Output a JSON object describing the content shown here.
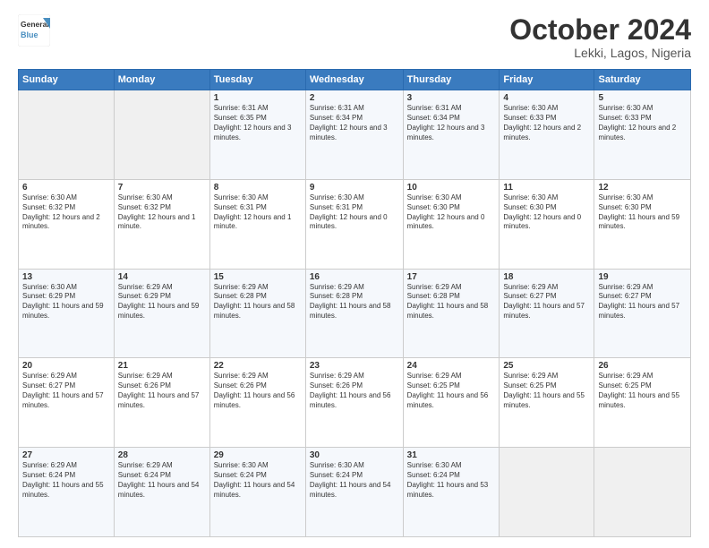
{
  "logo": {
    "line1": "General",
    "line2": "Blue"
  },
  "header": {
    "month": "October 2024",
    "location": "Lekki, Lagos, Nigeria"
  },
  "days_of_week": [
    "Sunday",
    "Monday",
    "Tuesday",
    "Wednesday",
    "Thursday",
    "Friday",
    "Saturday"
  ],
  "weeks": [
    [
      {
        "day": "",
        "info": ""
      },
      {
        "day": "",
        "info": ""
      },
      {
        "day": "1",
        "info": "Sunrise: 6:31 AM\nSunset: 6:35 PM\nDaylight: 12 hours and 3 minutes."
      },
      {
        "day": "2",
        "info": "Sunrise: 6:31 AM\nSunset: 6:34 PM\nDaylight: 12 hours and 3 minutes."
      },
      {
        "day": "3",
        "info": "Sunrise: 6:31 AM\nSunset: 6:34 PM\nDaylight: 12 hours and 3 minutes."
      },
      {
        "day": "4",
        "info": "Sunrise: 6:30 AM\nSunset: 6:33 PM\nDaylight: 12 hours and 2 minutes."
      },
      {
        "day": "5",
        "info": "Sunrise: 6:30 AM\nSunset: 6:33 PM\nDaylight: 12 hours and 2 minutes."
      }
    ],
    [
      {
        "day": "6",
        "info": "Sunrise: 6:30 AM\nSunset: 6:32 PM\nDaylight: 12 hours and 2 minutes."
      },
      {
        "day": "7",
        "info": "Sunrise: 6:30 AM\nSunset: 6:32 PM\nDaylight: 12 hours and 1 minute."
      },
      {
        "day": "8",
        "info": "Sunrise: 6:30 AM\nSunset: 6:31 PM\nDaylight: 12 hours and 1 minute."
      },
      {
        "day": "9",
        "info": "Sunrise: 6:30 AM\nSunset: 6:31 PM\nDaylight: 12 hours and 0 minutes."
      },
      {
        "day": "10",
        "info": "Sunrise: 6:30 AM\nSunset: 6:30 PM\nDaylight: 12 hours and 0 minutes."
      },
      {
        "day": "11",
        "info": "Sunrise: 6:30 AM\nSunset: 6:30 PM\nDaylight: 12 hours and 0 minutes."
      },
      {
        "day": "12",
        "info": "Sunrise: 6:30 AM\nSunset: 6:30 PM\nDaylight: 11 hours and 59 minutes."
      }
    ],
    [
      {
        "day": "13",
        "info": "Sunrise: 6:30 AM\nSunset: 6:29 PM\nDaylight: 11 hours and 59 minutes."
      },
      {
        "day": "14",
        "info": "Sunrise: 6:29 AM\nSunset: 6:29 PM\nDaylight: 11 hours and 59 minutes."
      },
      {
        "day": "15",
        "info": "Sunrise: 6:29 AM\nSunset: 6:28 PM\nDaylight: 11 hours and 58 minutes."
      },
      {
        "day": "16",
        "info": "Sunrise: 6:29 AM\nSunset: 6:28 PM\nDaylight: 11 hours and 58 minutes."
      },
      {
        "day": "17",
        "info": "Sunrise: 6:29 AM\nSunset: 6:28 PM\nDaylight: 11 hours and 58 minutes."
      },
      {
        "day": "18",
        "info": "Sunrise: 6:29 AM\nSunset: 6:27 PM\nDaylight: 11 hours and 57 minutes."
      },
      {
        "day": "19",
        "info": "Sunrise: 6:29 AM\nSunset: 6:27 PM\nDaylight: 11 hours and 57 minutes."
      }
    ],
    [
      {
        "day": "20",
        "info": "Sunrise: 6:29 AM\nSunset: 6:27 PM\nDaylight: 11 hours and 57 minutes."
      },
      {
        "day": "21",
        "info": "Sunrise: 6:29 AM\nSunset: 6:26 PM\nDaylight: 11 hours and 57 minutes."
      },
      {
        "day": "22",
        "info": "Sunrise: 6:29 AM\nSunset: 6:26 PM\nDaylight: 11 hours and 56 minutes."
      },
      {
        "day": "23",
        "info": "Sunrise: 6:29 AM\nSunset: 6:26 PM\nDaylight: 11 hours and 56 minutes."
      },
      {
        "day": "24",
        "info": "Sunrise: 6:29 AM\nSunset: 6:25 PM\nDaylight: 11 hours and 56 minutes."
      },
      {
        "day": "25",
        "info": "Sunrise: 6:29 AM\nSunset: 6:25 PM\nDaylight: 11 hours and 55 minutes."
      },
      {
        "day": "26",
        "info": "Sunrise: 6:29 AM\nSunset: 6:25 PM\nDaylight: 11 hours and 55 minutes."
      }
    ],
    [
      {
        "day": "27",
        "info": "Sunrise: 6:29 AM\nSunset: 6:24 PM\nDaylight: 11 hours and 55 minutes."
      },
      {
        "day": "28",
        "info": "Sunrise: 6:29 AM\nSunset: 6:24 PM\nDaylight: 11 hours and 54 minutes."
      },
      {
        "day": "29",
        "info": "Sunrise: 6:30 AM\nSunset: 6:24 PM\nDaylight: 11 hours and 54 minutes."
      },
      {
        "day": "30",
        "info": "Sunrise: 6:30 AM\nSunset: 6:24 PM\nDaylight: 11 hours and 54 minutes."
      },
      {
        "day": "31",
        "info": "Sunrise: 6:30 AM\nSunset: 6:24 PM\nDaylight: 11 hours and 53 minutes."
      },
      {
        "day": "",
        "info": ""
      },
      {
        "day": "",
        "info": ""
      }
    ]
  ]
}
